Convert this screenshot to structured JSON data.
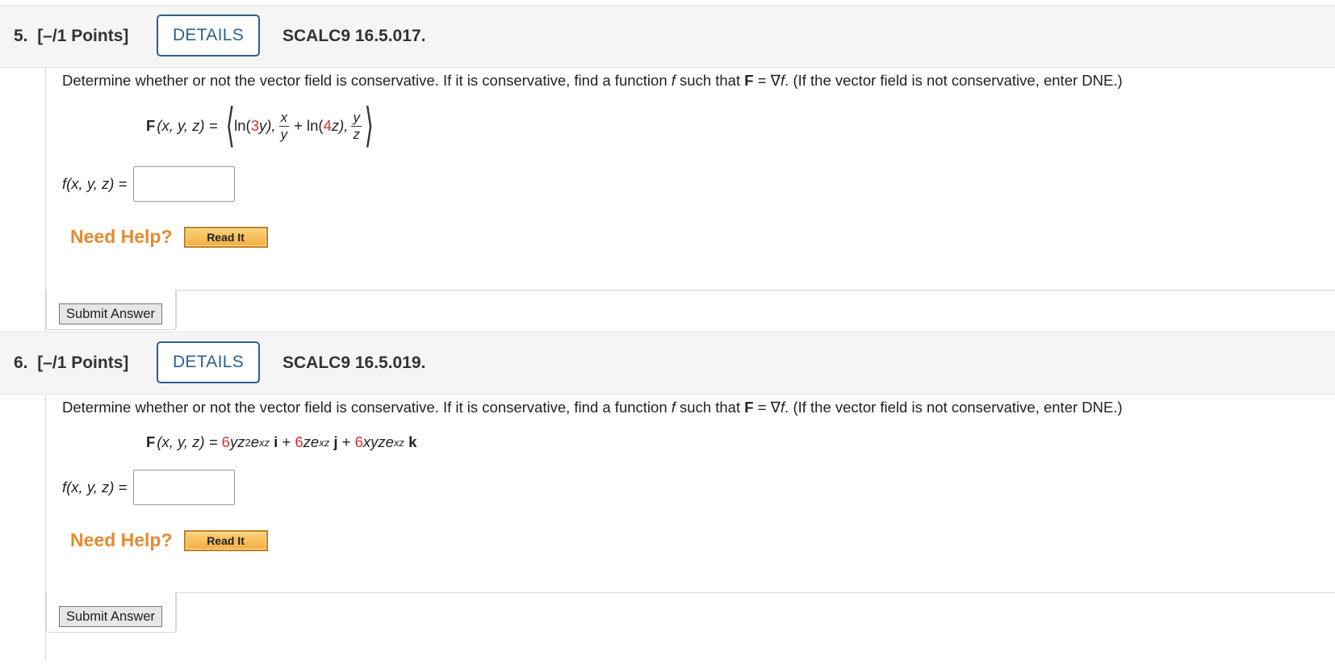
{
  "questions": [
    {
      "number": "5.",
      "points": "[–/1 Points]",
      "details_label": "DETAILS",
      "code": "SCALC9 16.5.017.",
      "prompt": {
        "p1": "Determine whether or not the vector field is conservative. If it is conservative, find a function ",
        "f": "f",
        "p2": " such that ",
        "F": "F",
        "p3": " = ∇",
        "f2": "f",
        "p4": ". (If the vector field is not conservative, enter DNE.)"
      },
      "formula": {
        "lhs_F": "F",
        "lhs_args": "(x, y, z) =",
        "ln1_a": "ln(",
        "ln1_coef": "3",
        "ln1_b": "y),",
        "frac1_num": "x",
        "frac1_den": "y",
        "plus_ln_a": "+ ln(",
        "ln2_coef": "4",
        "ln2_b": "z),",
        "frac2_num": "y",
        "frac2_den": "z"
      },
      "answer_label": "f(x, y, z) =",
      "answer_value": "",
      "need_help": "Need Help?",
      "read_it": "Read It",
      "submit": "Submit Answer"
    },
    {
      "number": "6.",
      "points": "[–/1 Points]",
      "details_label": "DETAILS",
      "code": "SCALC9 16.5.019.",
      "prompt": {
        "p1": "Determine whether or not the vector field is conservative. If it is conservative, find a function ",
        "f": "f",
        "p2": " such that ",
        "F": "F",
        "p3": " = ∇",
        "f2": "f",
        "p4": ". (If the vector field is not conservative, enter DNE.)"
      },
      "formula": {
        "lhs_F": "F",
        "lhs_args": "(x, y, z) =",
        "c1": "6",
        "t1a": "yz",
        "t1exp": "2",
        "t1b": "e",
        "t1e": "xz",
        "i": "i",
        "plus1": "+",
        "c2": "6",
        "t2a": "ze",
        "t2e": "xz",
        "j": "j",
        "plus2": "+",
        "c3": "6",
        "t3a": "xyze",
        "t3e": "xz",
        "k": "k"
      },
      "answer_label": "f(x, y, z) =",
      "answer_value": "",
      "need_help": "Need Help?",
      "read_it": "Read It",
      "submit": "Submit Answer"
    }
  ]
}
